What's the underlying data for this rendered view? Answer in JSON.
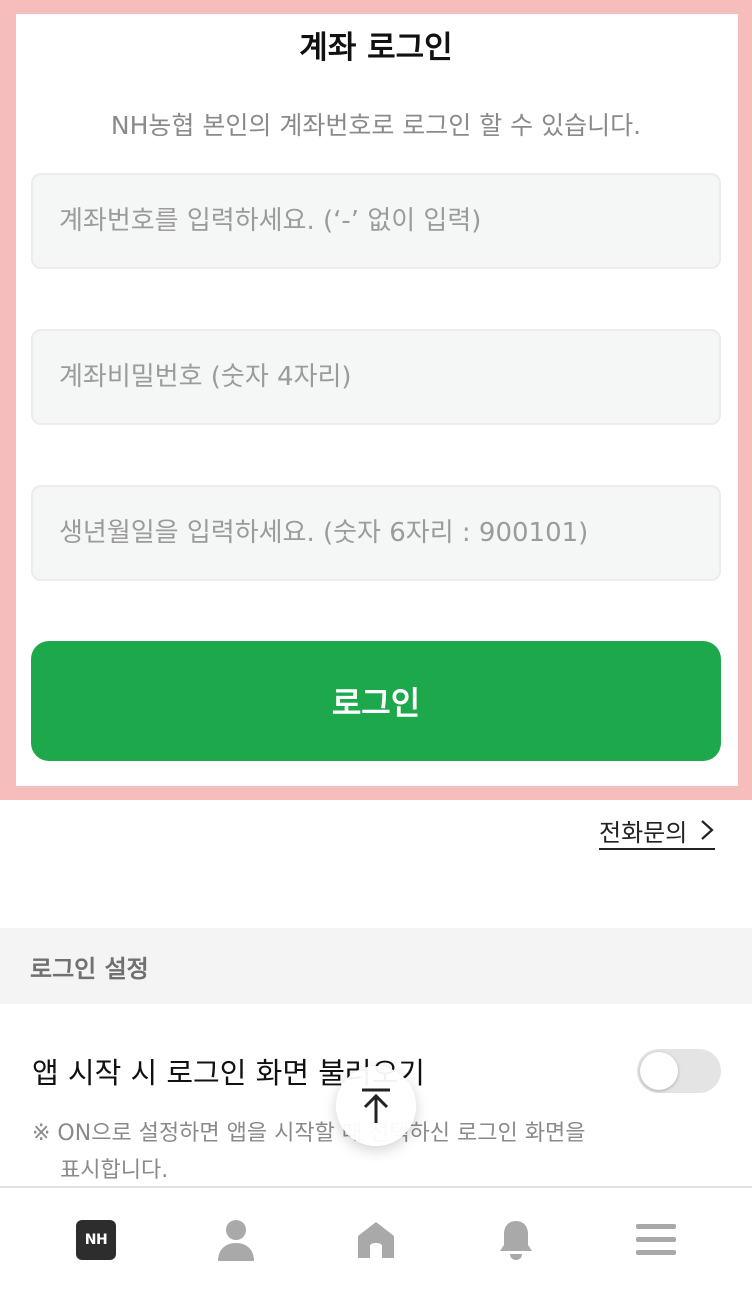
{
  "login": {
    "title": "계좌 로그인",
    "subtitle": "NH농협 본인의 계좌번호로 로그인 할 수 있습니다.",
    "account_placeholder": "계좌번호를 입력하세요. (‘-’ 없이 입력)",
    "password_placeholder": "계좌비밀번호 (숫자 4자리)",
    "birth_placeholder": "생년월일을 입력하세요. (숫자 6자리 : 900101)",
    "login_button": "로그인"
  },
  "phone_inquiry": "전화문의",
  "settings": {
    "section_title": "로그인 설정",
    "auto_login_label": "앱 시작 시 로그인 화면 불러오기",
    "auto_login_on": false,
    "note_line1": "※ ON으로 설정하면 앱을 시작할 때 선택하신 로그인 화면을",
    "note_line2": "표시합니다."
  },
  "bottom_nav": {
    "logo_text": "NH",
    "items": [
      "nh-logo",
      "person-icon",
      "home-icon",
      "bell-icon",
      "menu-icon"
    ]
  },
  "colors": {
    "accent_green": "#1da84c",
    "highlight_frame": "#f7bcbc",
    "icon_gray": "#a9a9a9"
  }
}
